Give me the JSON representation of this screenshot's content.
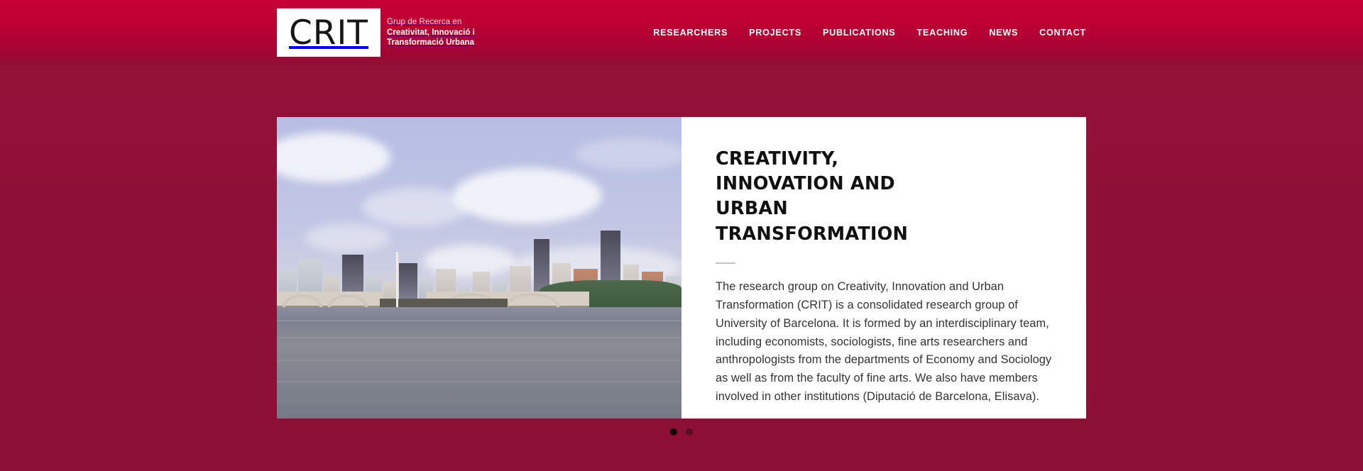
{
  "header": {
    "logo": {
      "wordmark": "CRIT",
      "tagline_pre": "Grup de Recerca en",
      "tagline_line1": "Creativitat, Innovació i",
      "tagline_line2": "Transformació Urbana"
    },
    "nav": [
      {
        "label": "RESEARCHERS",
        "name": "nav-researchers"
      },
      {
        "label": "PROJECTS",
        "name": "nav-projects"
      },
      {
        "label": "PUBLICATIONS",
        "name": "nav-publications"
      },
      {
        "label": "TEACHING",
        "name": "nav-teaching"
      },
      {
        "label": "NEWS",
        "name": "nav-news"
      },
      {
        "label": "CONTACT",
        "name": "nav-contact"
      }
    ]
  },
  "hero": {
    "image_alt": "city skyline across a river with arched bridges and boats",
    "title": "CREATIVITY, INNOVATION AND URBAN TRANSFORMATION",
    "body": "The research group on Creativity, Innovation and Urban Transformation (CRIT) is a consolidated research group of University of Barcelona. It is formed by an interdisciplinary team, including economists, sociologists, fine arts researchers and anthropologists from the departments of Economy and Sociology as well as from the faculty of fine arts. We also have members involved in other institutions (Diputació de Barcelona, Elisava).",
    "slides": [
      {
        "index": "1",
        "active": true
      },
      {
        "index": "2",
        "active": false
      }
    ]
  },
  "colors": {
    "brand_crimson": "#c60033",
    "page_maroon": "#8e1036",
    "dot_active": "#160405",
    "dot_inactive": "#5d0c22",
    "panel_bg": "#ffffff",
    "rule_gray": "#c3c3c3"
  }
}
